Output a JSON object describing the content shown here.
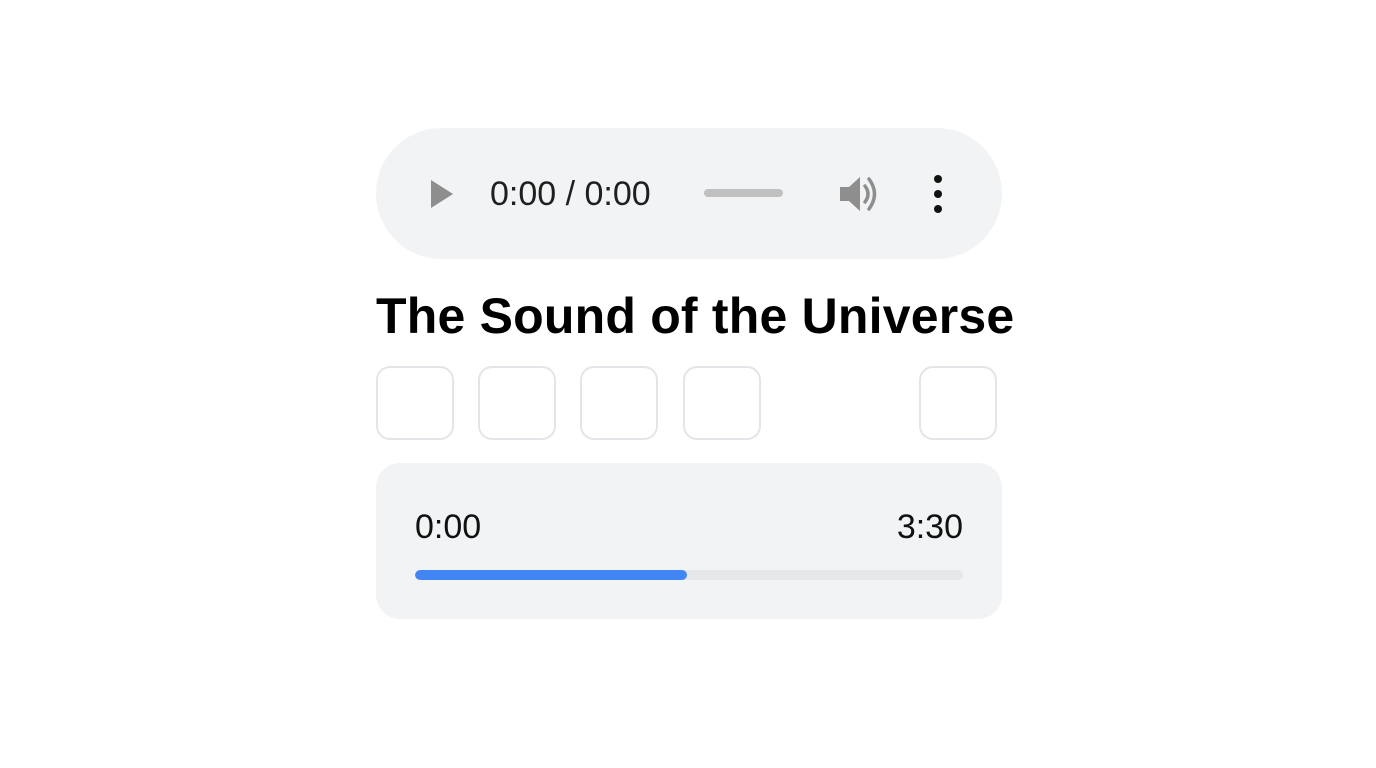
{
  "player": {
    "time_display": "0:00 / 0:00"
  },
  "track": {
    "title": "The Sound of the Universe"
  },
  "progress": {
    "current_time": "0:00",
    "total_time": "3:30",
    "fraction": 0.497,
    "fill_color": "#4285f4"
  },
  "icons": {
    "play": "play-icon",
    "volume": "volume-icon",
    "menu": "more-vert-icon"
  }
}
